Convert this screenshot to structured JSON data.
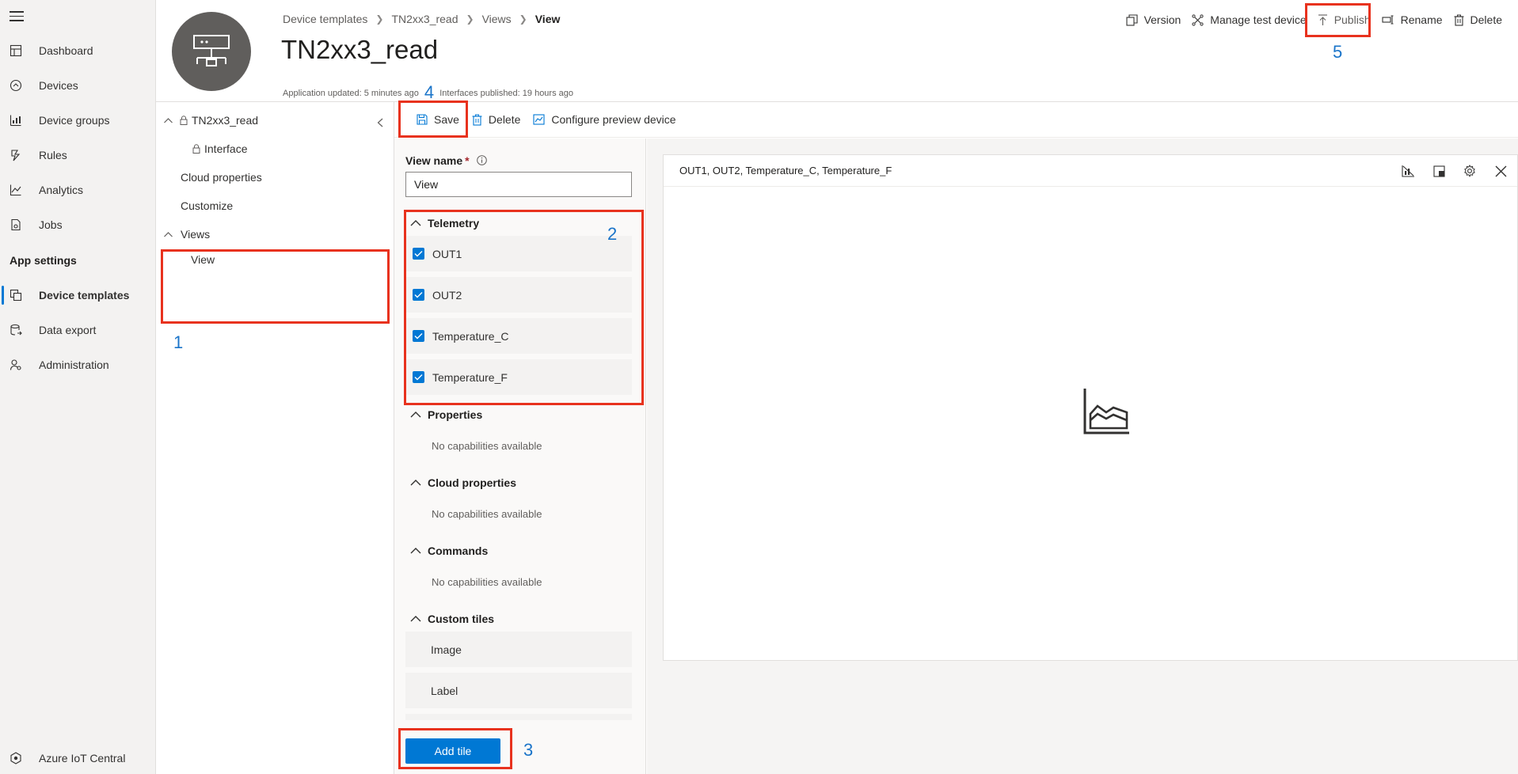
{
  "nav": {
    "items": [
      {
        "label": "Dashboard",
        "icon": "dashboard-icon"
      },
      {
        "label": "Devices",
        "icon": "devices-icon"
      },
      {
        "label": "Device groups",
        "icon": "device-groups-icon"
      },
      {
        "label": "Rules",
        "icon": "rules-icon"
      },
      {
        "label": "Analytics",
        "icon": "analytics-icon"
      },
      {
        "label": "Jobs",
        "icon": "jobs-icon"
      }
    ],
    "section_title": "App settings",
    "settings_items": [
      {
        "label": "Device templates",
        "icon": "device-templates-icon",
        "active": true
      },
      {
        "label": "Data export",
        "icon": "data-export-icon"
      },
      {
        "label": "Administration",
        "icon": "administration-icon"
      }
    ],
    "footer_label": "Azure IoT Central"
  },
  "header": {
    "breadcrumb": [
      "Device templates",
      "TN2xx3_read",
      "Views",
      "View"
    ],
    "title": "TN2xx3_read",
    "app_updated": "Application updated: 5 minutes ago",
    "interfaces_published": "Interfaces published: 19 hours ago",
    "actions": {
      "version": "Version",
      "manage_test_device": "Manage test device",
      "publish": "Publish",
      "rename": "Rename",
      "delete": "Delete"
    }
  },
  "tree": {
    "root": "TN2xx3_read",
    "interface": "Interface",
    "cloud_properties": "Cloud properties",
    "customize": "Customize",
    "views": "Views",
    "view": "View"
  },
  "toolbar": {
    "save": "Save",
    "delete": "Delete",
    "configure": "Configure preview device"
  },
  "panel": {
    "view_name_label": "View name",
    "required_mark": "*",
    "view_name_value": "View",
    "telemetry": {
      "title": "Telemetry",
      "items": [
        "OUT1",
        "OUT2",
        "Temperature_C",
        "Temperature_F"
      ]
    },
    "properties": {
      "title": "Properties",
      "empty": "No capabilities available"
    },
    "cloud_properties": {
      "title": "Cloud properties",
      "empty": "No capabilities available"
    },
    "commands": {
      "title": "Commands",
      "empty": "No capabilities available"
    },
    "custom_tiles": {
      "title": "Custom tiles",
      "items": [
        "Image",
        "Label"
      ]
    },
    "add_tile": "Add tile"
  },
  "tile": {
    "title": "OUT1, OUT2, Temperature_C, Temperature_F"
  },
  "callouts": [
    "1",
    "2",
    "3",
    "4",
    "5"
  ],
  "colors": {
    "accent": "#0078d4",
    "highlight": "#e8321e",
    "callout": "#1a74c9"
  }
}
